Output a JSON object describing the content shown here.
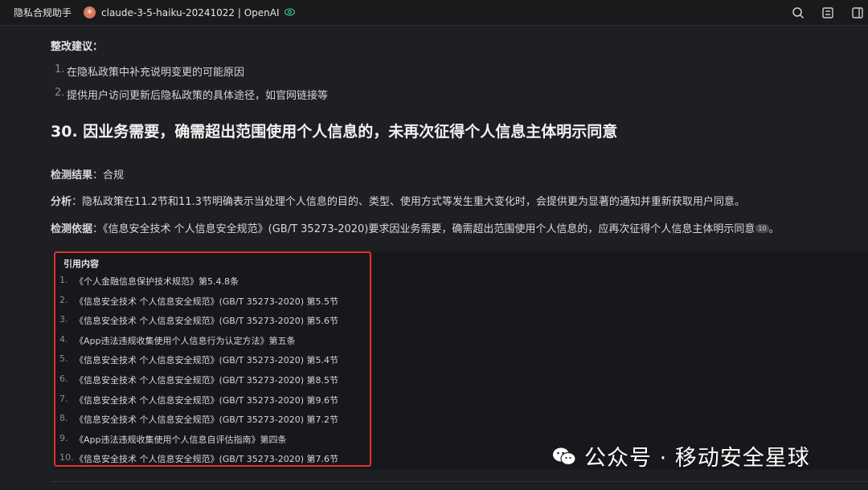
{
  "topbar": {
    "app_title": "隐私合规助手",
    "model_name": "claude-3-5-haiku-20241022 | OpenAI",
    "icons": [
      "search-icon",
      "layout-icon",
      "sidebar-icon"
    ]
  },
  "content": {
    "suggest_title": "整改建议：",
    "suggest_items": [
      {
        "num": "1.",
        "text": "在隐私政策中补充说明变更的可能原因"
      },
      {
        "num": "2.",
        "text": "提供用户访问更新后隐私政策的具体途径，如官网链接等"
      }
    ],
    "heading": "30. 因业务需要，确需超出范围使用个人信息的，未再次征得个人信息主体明示同意",
    "result_label": "检测结果",
    "result_value": "：合规",
    "analysis_label": "分析",
    "analysis_text": "：隐私政策在11.2节和11.3节明确表示当处理个人信息的目的、类型、使用方式等发生重大变化时，会提供更为显著的通知并重新获取用户同意。",
    "basis_label": "检测依据",
    "basis_text": "：《信息安全技术 个人信息安全规范》(GB/T 35273-2020)要求因业务需要，确需超出范围使用个人信息的，应再次征得个人信息主体明示同意",
    "basis_ref": "10",
    "basis_end": "。"
  },
  "refs": {
    "title": "引用内容",
    "items": [
      {
        "num": "1.",
        "text": "《个人金融信息保护技术规范》第5.4.8条"
      },
      {
        "num": "2.",
        "text": "《信息安全技术 个人信息安全规范》(GB/T 35273-2020) 第5.5节"
      },
      {
        "num": "3.",
        "text": "《信息安全技术 个人信息安全规范》(GB/T 35273-2020) 第5.6节"
      },
      {
        "num": "4.",
        "text": "《App违法违规收集使用个人信息行为认定方法》第五条"
      },
      {
        "num": "5.",
        "text": "《信息安全技术 个人信息安全规范》(GB/T 35273-2020) 第5.4节"
      },
      {
        "num": "6.",
        "text": "《信息安全技术 个人信息安全规范》(GB/T 35273-2020) 第8.5节"
      },
      {
        "num": "7.",
        "text": "《信息安全技术 个人信息安全规范》(GB/T 35273-2020) 第9.6节"
      },
      {
        "num": "8.",
        "text": "《信息安全技术 个人信息安全规范》(GB/T 35273-2020) 第7.2节"
      },
      {
        "num": "9.",
        "text": "《App违法违规收集使用个人信息自评估指南》第四条"
      },
      {
        "num": "10.",
        "text": "《信息安全技术 个人信息安全规范》(GB/T 35273-2020) 第7.6节"
      }
    ]
  },
  "watermark": {
    "text": "公众号 · 移动安全星球"
  },
  "colors": {
    "background": "#1e1f22",
    "highlight_border": "#e0332c",
    "model_badge": "#d9775a",
    "visible_icon": "#3fb27f"
  }
}
